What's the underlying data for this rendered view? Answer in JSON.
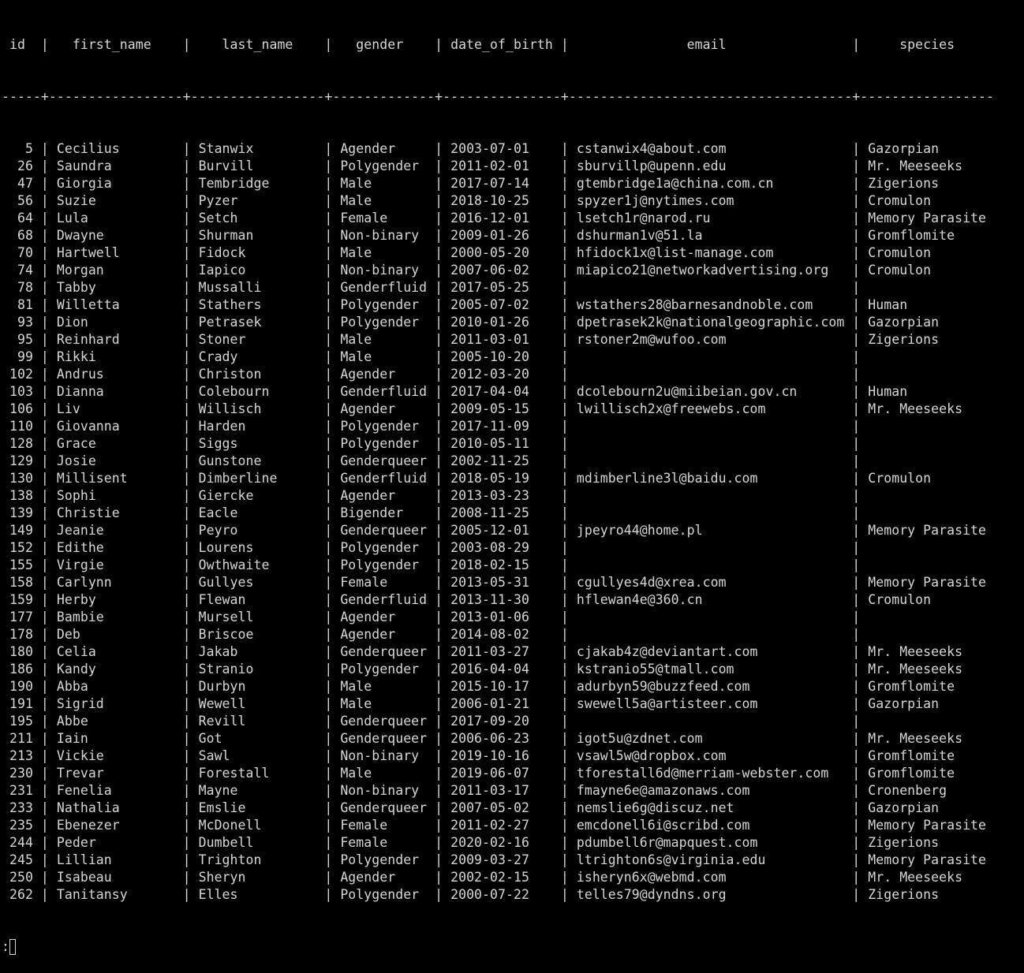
{
  "terminal": {
    "columns": [
      {
        "key": "id",
        "header": "id",
        "width": 5,
        "align": "right"
      },
      {
        "key": "first_name",
        "header": "first_name",
        "width": 17,
        "align": "left"
      },
      {
        "key": "last_name",
        "header": "last_name",
        "width": 17,
        "align": "left"
      },
      {
        "key": "gender",
        "header": "gender",
        "width": 13,
        "align": "left"
      },
      {
        "key": "date_of_birth",
        "header": "date_of_birth",
        "width": 15,
        "align": "left"
      },
      {
        "key": "email",
        "header": "email",
        "width": 36,
        "align": "left"
      },
      {
        "key": "species",
        "header": "species",
        "width": 17,
        "align": "left"
      }
    ],
    "rows": [
      {
        "id": "5",
        "first_name": "Cecilius",
        "last_name": "Stanwix",
        "gender": "Agender",
        "date_of_birth": "2003-07-01",
        "email": "cstanwix4@about.com",
        "species": "Gazorpian"
      },
      {
        "id": "26",
        "first_name": "Saundra",
        "last_name": "Burvill",
        "gender": "Polygender",
        "date_of_birth": "2011-02-01",
        "email": "sburvillp@upenn.edu",
        "species": "Mr. Meeseeks"
      },
      {
        "id": "47",
        "first_name": "Giorgia",
        "last_name": "Tembridge",
        "gender": "Male",
        "date_of_birth": "2017-07-14",
        "email": "gtembridge1a@china.com.cn",
        "species": "Zigerions"
      },
      {
        "id": "56",
        "first_name": "Suzie",
        "last_name": "Pyzer",
        "gender": "Male",
        "date_of_birth": "2018-10-25",
        "email": "spyzer1j@nytimes.com",
        "species": "Cromulon"
      },
      {
        "id": "64",
        "first_name": "Lula",
        "last_name": "Setch",
        "gender": "Female",
        "date_of_birth": "2016-12-01",
        "email": "lsetch1r@narod.ru",
        "species": "Memory Parasite"
      },
      {
        "id": "68",
        "first_name": "Dwayne",
        "last_name": "Shurman",
        "gender": "Non-binary",
        "date_of_birth": "2009-01-26",
        "email": "dshurman1v@51.la",
        "species": "Gromflomite"
      },
      {
        "id": "70",
        "first_name": "Hartwell",
        "last_name": "Fidock",
        "gender": "Male",
        "date_of_birth": "2000-05-20",
        "email": "hfidock1x@list-manage.com",
        "species": "Cromulon"
      },
      {
        "id": "74",
        "first_name": "Morgan",
        "last_name": "Iapico",
        "gender": "Non-binary",
        "date_of_birth": "2007-06-02",
        "email": "miapico21@networkadvertising.org",
        "species": "Cromulon"
      },
      {
        "id": "78",
        "first_name": "Tabby",
        "last_name": "Mussalli",
        "gender": "Genderfluid",
        "date_of_birth": "2017-05-25",
        "email": "",
        "species": ""
      },
      {
        "id": "81",
        "first_name": "Willetta",
        "last_name": "Stathers",
        "gender": "Polygender",
        "date_of_birth": "2005-07-02",
        "email": "wstathers28@barnesandnoble.com",
        "species": "Human"
      },
      {
        "id": "93",
        "first_name": "Dion",
        "last_name": "Petrasek",
        "gender": "Polygender",
        "date_of_birth": "2010-01-26",
        "email": "dpetrasek2k@nationalgeographic.com",
        "species": "Gazorpian"
      },
      {
        "id": "95",
        "first_name": "Reinhard",
        "last_name": "Stoner",
        "gender": "Male",
        "date_of_birth": "2011-03-01",
        "email": "rstoner2m@wufoo.com",
        "species": "Zigerions"
      },
      {
        "id": "99",
        "first_name": "Rikki",
        "last_name": "Crady",
        "gender": "Male",
        "date_of_birth": "2005-10-20",
        "email": "",
        "species": ""
      },
      {
        "id": "102",
        "first_name": "Andrus",
        "last_name": "Christon",
        "gender": "Agender",
        "date_of_birth": "2012-03-20",
        "email": "",
        "species": ""
      },
      {
        "id": "103",
        "first_name": "Dianna",
        "last_name": "Colebourn",
        "gender": "Genderfluid",
        "date_of_birth": "2017-04-04",
        "email": "dcolebourn2u@miibeian.gov.cn",
        "species": "Human"
      },
      {
        "id": "106",
        "first_name": "Liv",
        "last_name": "Willisch",
        "gender": "Agender",
        "date_of_birth": "2009-05-15",
        "email": "lwillisch2x@freewebs.com",
        "species": "Mr. Meeseeks"
      },
      {
        "id": "110",
        "first_name": "Giovanna",
        "last_name": "Harden",
        "gender": "Polygender",
        "date_of_birth": "2017-11-09",
        "email": "",
        "species": ""
      },
      {
        "id": "128",
        "first_name": "Grace",
        "last_name": "Siggs",
        "gender": "Polygender",
        "date_of_birth": "2010-05-11",
        "email": "",
        "species": ""
      },
      {
        "id": "129",
        "first_name": "Josie",
        "last_name": "Gunstone",
        "gender": "Genderqueer",
        "date_of_birth": "2002-11-25",
        "email": "",
        "species": ""
      },
      {
        "id": "130",
        "first_name": "Millisent",
        "last_name": "Dimberline",
        "gender": "Genderfluid",
        "date_of_birth": "2018-05-19",
        "email": "mdimberline3l@baidu.com",
        "species": "Cromulon"
      },
      {
        "id": "138",
        "first_name": "Sophi",
        "last_name": "Giercke",
        "gender": "Agender",
        "date_of_birth": "2013-03-23",
        "email": "",
        "species": ""
      },
      {
        "id": "139",
        "first_name": "Christie",
        "last_name": "Eacle",
        "gender": "Bigender",
        "date_of_birth": "2008-11-25",
        "email": "",
        "species": ""
      },
      {
        "id": "149",
        "first_name": "Jeanie",
        "last_name": "Peyro",
        "gender": "Genderqueer",
        "date_of_birth": "2005-12-01",
        "email": "jpeyro44@home.pl",
        "species": "Memory Parasite"
      },
      {
        "id": "152",
        "first_name": "Edithe",
        "last_name": "Lourens",
        "gender": "Polygender",
        "date_of_birth": "2003-08-29",
        "email": "",
        "species": ""
      },
      {
        "id": "155",
        "first_name": "Virgie",
        "last_name": "Owthwaite",
        "gender": "Polygender",
        "date_of_birth": "2018-02-15",
        "email": "",
        "species": ""
      },
      {
        "id": "158",
        "first_name": "Carlynn",
        "last_name": "Gullyes",
        "gender": "Female",
        "date_of_birth": "2013-05-31",
        "email": "cgullyes4d@xrea.com",
        "species": "Memory Parasite"
      },
      {
        "id": "159",
        "first_name": "Herby",
        "last_name": "Flewan",
        "gender": "Genderfluid",
        "date_of_birth": "2013-11-30",
        "email": "hflewan4e@360.cn",
        "species": "Cromulon"
      },
      {
        "id": "177",
        "first_name": "Bambie",
        "last_name": "Mursell",
        "gender": "Agender",
        "date_of_birth": "2013-01-06",
        "email": "",
        "species": ""
      },
      {
        "id": "178",
        "first_name": "Deb",
        "last_name": "Briscoe",
        "gender": "Agender",
        "date_of_birth": "2014-08-02",
        "email": "",
        "species": ""
      },
      {
        "id": "180",
        "first_name": "Celia",
        "last_name": "Jakab",
        "gender": "Genderqueer",
        "date_of_birth": "2011-03-27",
        "email": "cjakab4z@deviantart.com",
        "species": "Mr. Meeseeks"
      },
      {
        "id": "186",
        "first_name": "Kandy",
        "last_name": "Stranio",
        "gender": "Polygender",
        "date_of_birth": "2016-04-04",
        "email": "kstranio55@tmall.com",
        "species": "Mr. Meeseeks"
      },
      {
        "id": "190",
        "first_name": "Abba",
        "last_name": "Durbyn",
        "gender": "Male",
        "date_of_birth": "2015-10-17",
        "email": "adurbyn59@buzzfeed.com",
        "species": "Gromflomite"
      },
      {
        "id": "191",
        "first_name": "Sigrid",
        "last_name": "Wewell",
        "gender": "Male",
        "date_of_birth": "2006-01-21",
        "email": "swewell5a@artisteer.com",
        "species": "Gazorpian"
      },
      {
        "id": "195",
        "first_name": "Abbe",
        "last_name": "Revill",
        "gender": "Genderqueer",
        "date_of_birth": "2017-09-20",
        "email": "",
        "species": ""
      },
      {
        "id": "211",
        "first_name": "Iain",
        "last_name": "Got",
        "gender": "Genderqueer",
        "date_of_birth": "2006-06-23",
        "email": "igot5u@zdnet.com",
        "species": "Mr. Meeseeks"
      },
      {
        "id": "213",
        "first_name": "Vickie",
        "last_name": "Sawl",
        "gender": "Non-binary",
        "date_of_birth": "2019-10-16",
        "email": "vsawl5w@dropbox.com",
        "species": "Gromflomite"
      },
      {
        "id": "230",
        "first_name": "Trevar",
        "last_name": "Forestall",
        "gender": "Male",
        "date_of_birth": "2019-06-07",
        "email": "tforestall6d@merriam-webster.com",
        "species": "Gromflomite"
      },
      {
        "id": "231",
        "first_name": "Fenelia",
        "last_name": "Mayne",
        "gender": "Non-binary",
        "date_of_birth": "2011-03-17",
        "email": "fmayne6e@amazonaws.com",
        "species": "Cronenberg"
      },
      {
        "id": "233",
        "first_name": "Nathalia",
        "last_name": "Emslie",
        "gender": "Genderqueer",
        "date_of_birth": "2007-05-02",
        "email": "nemslie6g@discuz.net",
        "species": "Gazorpian"
      },
      {
        "id": "235",
        "first_name": "Ebenezer",
        "last_name": "McDonell",
        "gender": "Female",
        "date_of_birth": "2011-02-27",
        "email": "emcdonell6i@scribd.com",
        "species": "Memory Parasite"
      },
      {
        "id": "244",
        "first_name": "Peder",
        "last_name": "Dumbell",
        "gender": "Female",
        "date_of_birth": "2020-02-16",
        "email": "pdumbell6r@mapquest.com",
        "species": "Zigerions"
      },
      {
        "id": "245",
        "first_name": "Lillian",
        "last_name": "Trighton",
        "gender": "Polygender",
        "date_of_birth": "2009-03-27",
        "email": "ltrighton6s@virginia.edu",
        "species": "Memory Parasite"
      },
      {
        "id": "250",
        "first_name": "Isabeau",
        "last_name": "Sheryn",
        "gender": "Agender",
        "date_of_birth": "2002-02-15",
        "email": "isheryn6x@webmd.com",
        "species": "Mr. Meeseeks"
      },
      {
        "id": "262",
        "first_name": "Tanitansy",
        "last_name": "Elles",
        "gender": "Polygender",
        "date_of_birth": "2000-07-22",
        "email": "telles79@dyndns.org",
        "species": "Zigerions"
      }
    ],
    "pager_prompt": ":"
  }
}
